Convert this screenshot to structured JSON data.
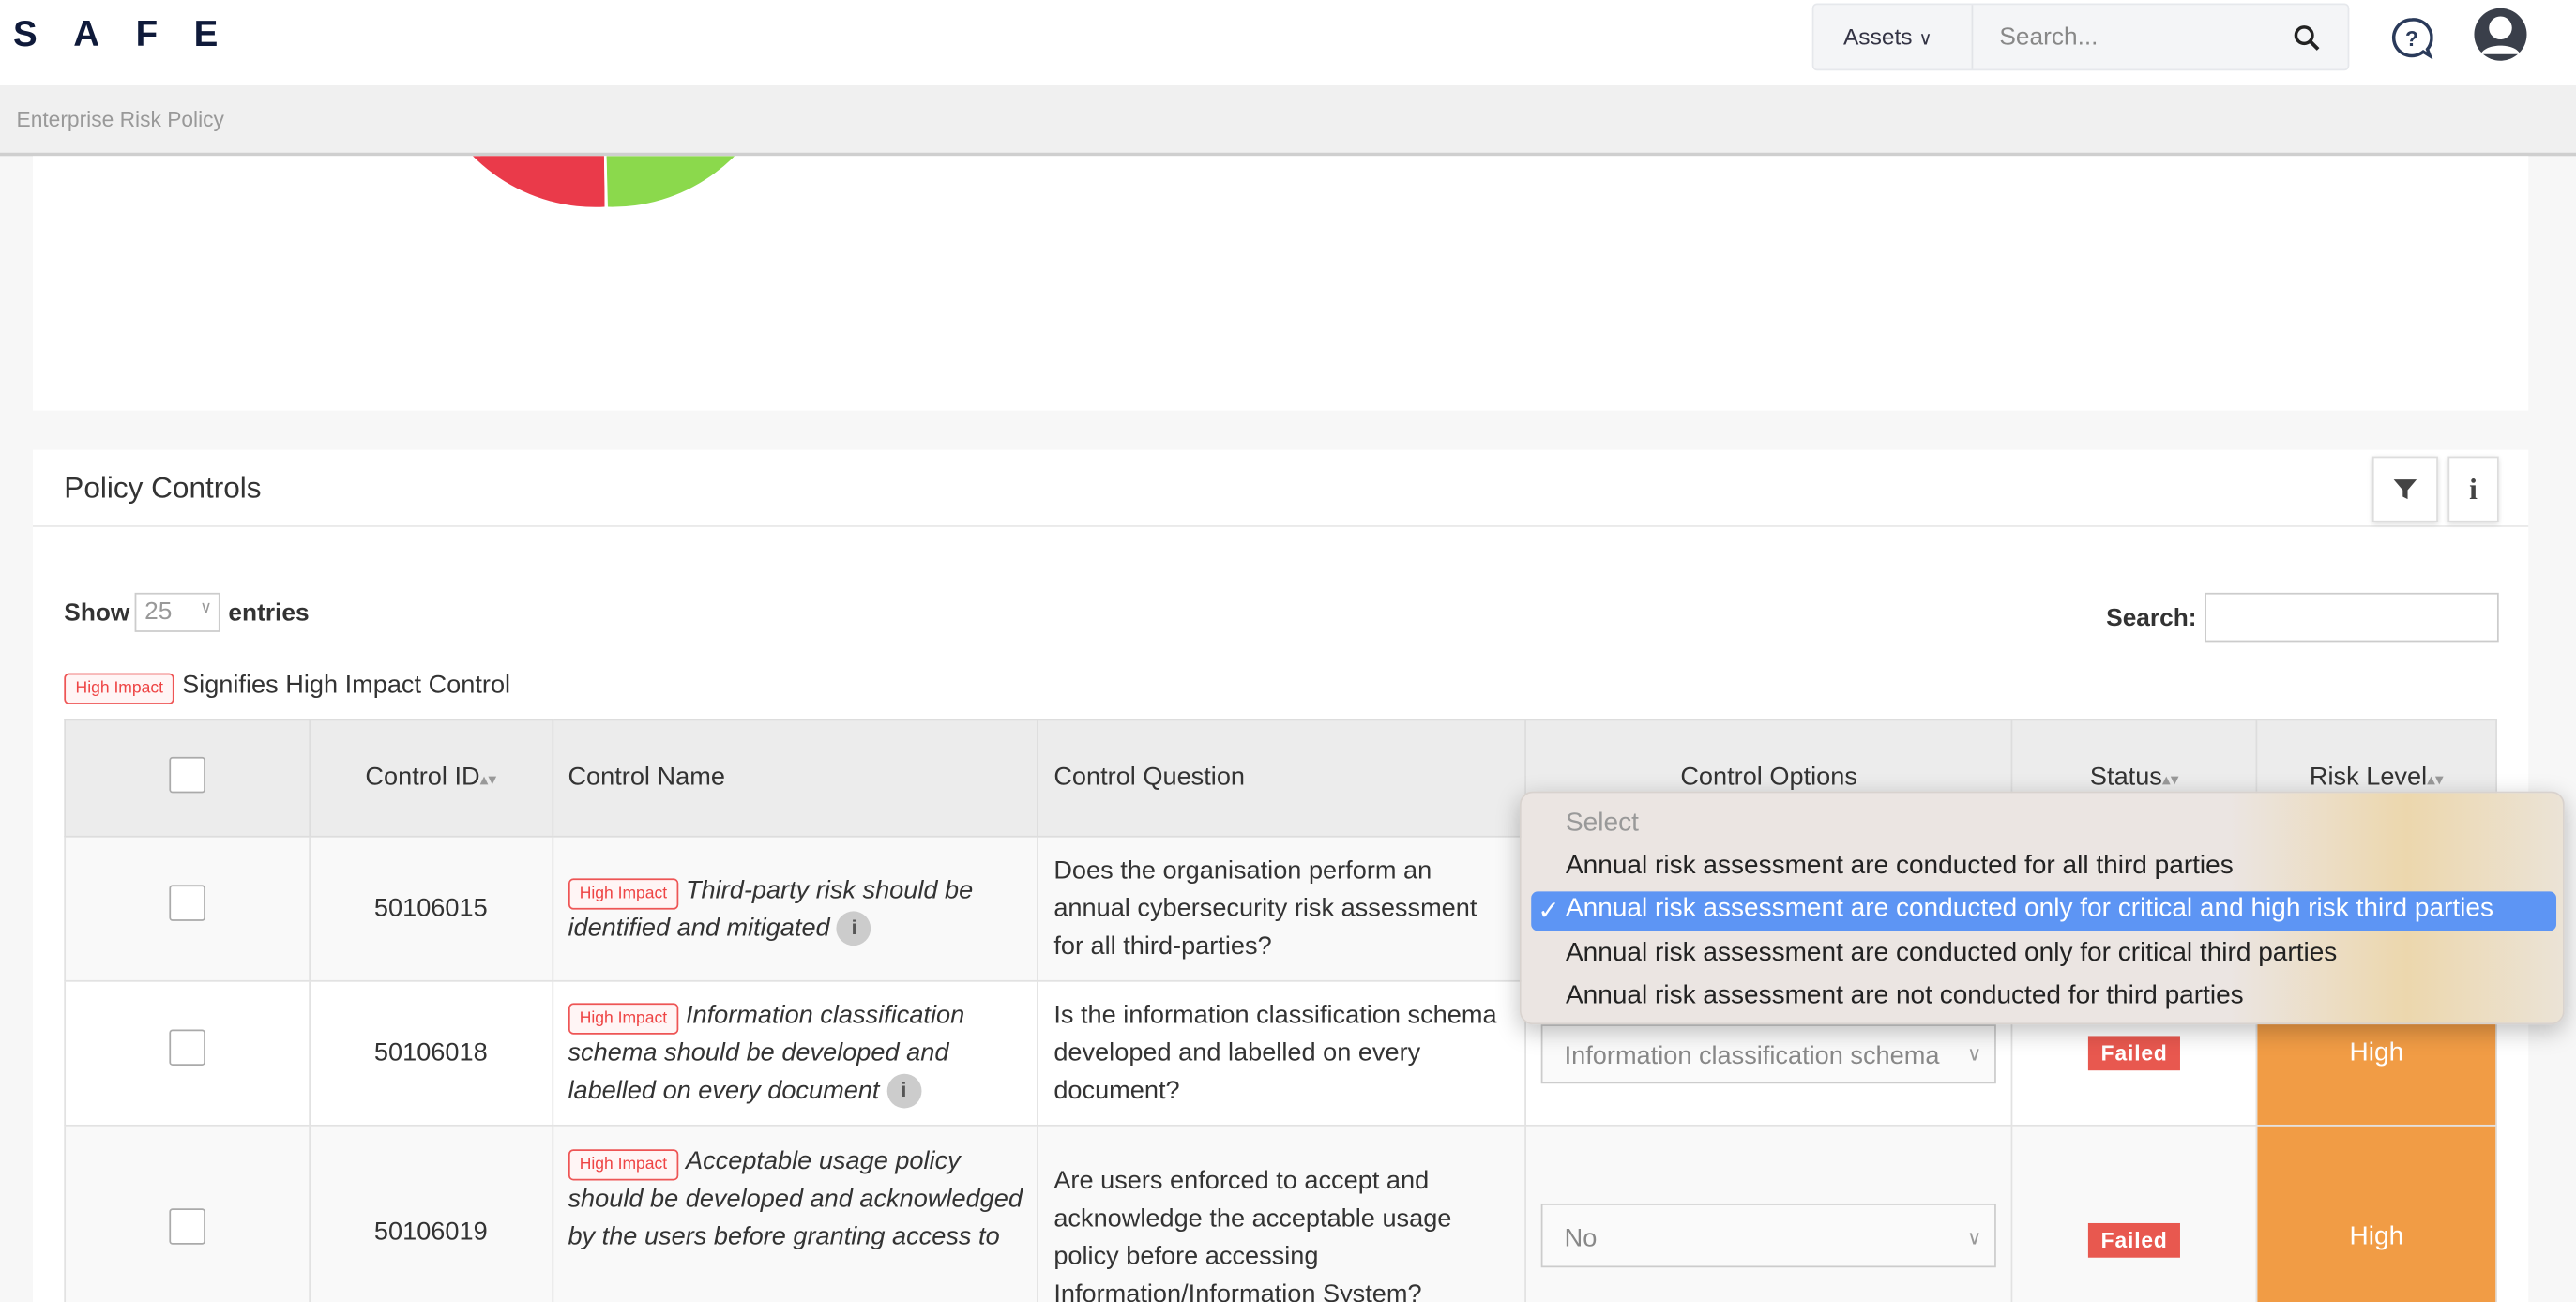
{
  "header": {
    "logo": "SAFE",
    "assets_label": "Assets",
    "search_placeholder": "Search...",
    "icons": [
      "search-icon",
      "help-icon",
      "user-avatar-icon"
    ]
  },
  "breadcrumb": "Enterprise Risk Policy",
  "chart_data": {
    "type": "pie",
    "note_visible": "partial pie, only bottom part visible",
    "colors": [
      "#ea3a4a",
      "#8bd94c"
    ]
  },
  "policy_controls": {
    "title": "Policy Controls",
    "show_label": "Show",
    "entries_value": "25",
    "entries_label": "entries",
    "search_label": "Search:",
    "legend_badge": "High Impact",
    "legend_text": "Signifies High Impact Control",
    "columns": [
      "Control ID",
      "Control Name",
      "Control Question",
      "Control Options",
      "Status",
      "Risk Level"
    ],
    "rows": [
      {
        "id": "50106015",
        "badge": "High Impact",
        "name": "Third-party risk should be identified and mitigated",
        "question": "Does the organisation perform an annual cybersecurity risk assessment for all third-parties?"
      },
      {
        "id": "50106018",
        "badge": "High Impact",
        "name": "Information classification schema should be developed and labelled on every document",
        "question": "Is the information classification schema developed and labelled on every document?",
        "option": "Information classification schema",
        "status": "Failed",
        "risk": "High"
      },
      {
        "id": "50106019",
        "badge": "High Impact",
        "name": "Acceptable usage policy should be developed and acknowledged by the users before granting access to",
        "question": "Are users enforced to accept and acknowledge the acceptable usage policy before accessing Information/Information System?",
        "option": "No",
        "status": "Failed",
        "risk": "High"
      }
    ],
    "colors": {
      "failed": "#e8584f",
      "high_risk": "#f19c45",
      "high_impact": "#e44444"
    }
  },
  "dropdown": {
    "placeholder": "Select",
    "options": [
      "Annual risk assessment are conducted for all third parties",
      "Annual risk assessment are conducted only for critical and high risk third parties",
      "Annual risk assessment are conducted only for critical third parties",
      "Annual risk assessment are not conducted for third parties"
    ],
    "selected_index": 1,
    "check": "✓",
    "highlight_color": "#5d95f4"
  }
}
